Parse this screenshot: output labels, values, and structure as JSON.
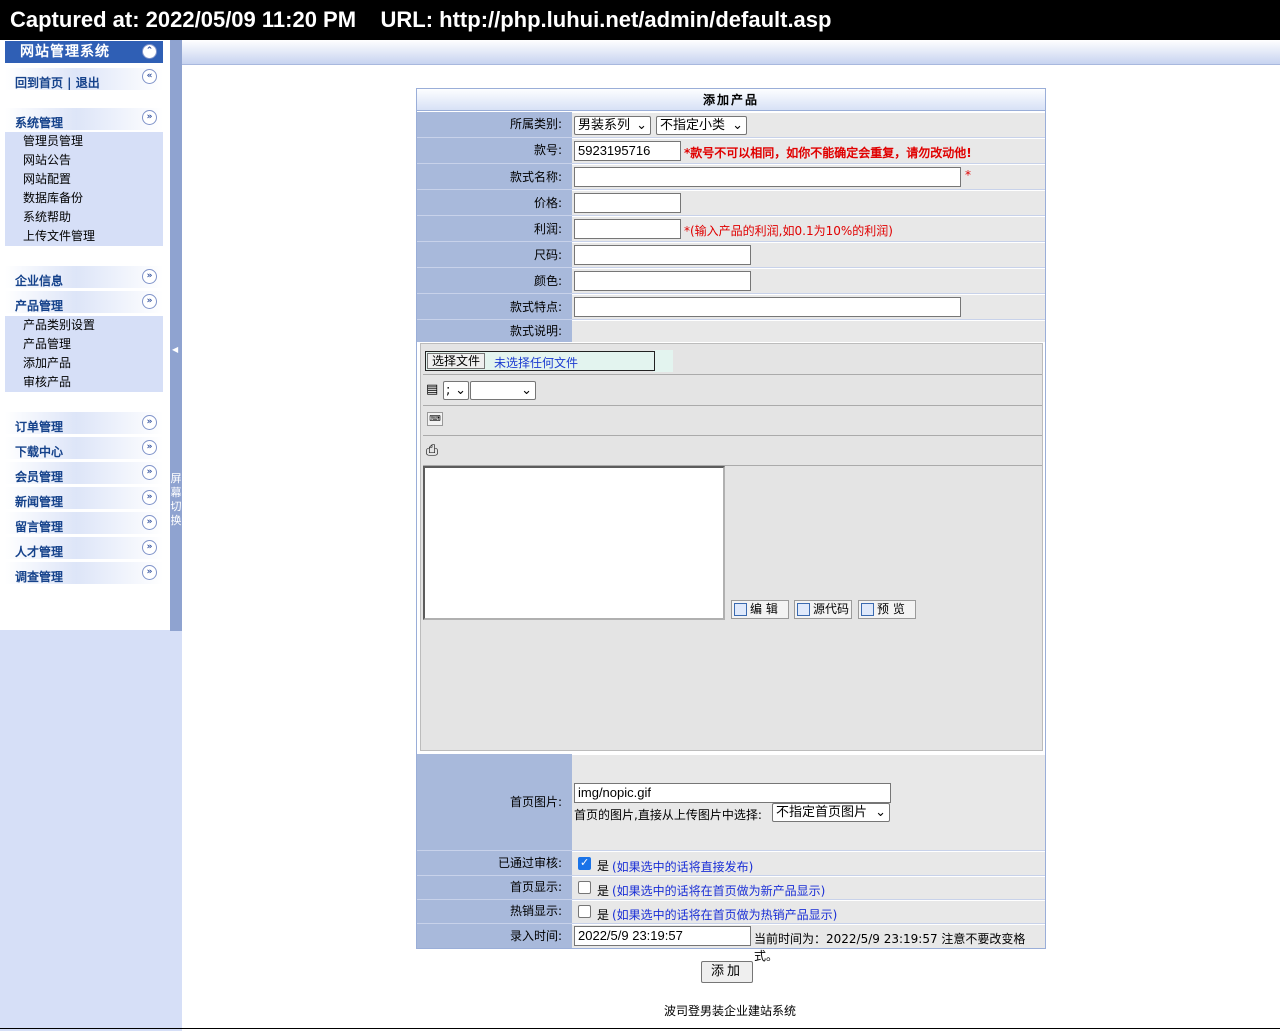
{
  "capture": {
    "text": "Captured at: 2022/05/09 11:20 PM    URL: http://php.luhui.net/admin/default.asp"
  },
  "sidebar": {
    "title": "网站管理系统",
    "top_link": "回到首页 | 退出",
    "groups": [
      {
        "label": "系统管理",
        "items": [
          "管理员管理",
          "网站公告",
          "网站配置",
          "数据库备份",
          "系统帮助",
          "上传文件管理"
        ]
      },
      {
        "label": "企业信息",
        "items": []
      },
      {
        "label": "产品管理",
        "items": [
          "产品类别设置",
          "产品管理",
          "添加产品",
          "审核产品"
        ]
      },
      {
        "label": "订单管理",
        "items": []
      },
      {
        "label": "下载中心",
        "items": []
      },
      {
        "label": "会员管理",
        "items": []
      },
      {
        "label": "新闻管理",
        "items": []
      },
      {
        "label": "留言管理",
        "items": []
      },
      {
        "label": "人才管理",
        "items": []
      },
      {
        "label": "调查管理",
        "items": []
      }
    ],
    "toggle_label": "屏幕切换"
  },
  "form": {
    "title": "添加产品",
    "category_label": "所属类别:",
    "category_main": "男装系列",
    "category_sub": "不指定小类",
    "code_label": "款号:",
    "code_value": "5923195716",
    "code_warning": "*款号不可以相同，如你不能确定会重复，请勿改动他!",
    "name_label": "款式名称:",
    "name_value": "",
    "required_mark": "*",
    "price_label": "价格:",
    "price_value": "",
    "profit_label": "利润:",
    "profit_value": "",
    "profit_hint": "*(输入产品的利润,如0.1为10%的利润)",
    "size_label": "尺码:",
    "size_value": "",
    "color_label": "颜色:",
    "color_value": "",
    "feature_label": "款式特点:",
    "feature_value": "",
    "desc_label": "款式说明:",
    "editor": {
      "file_button": "选择文件",
      "file_status": "未选择任何文件",
      "font_select": ";",
      "size_select": "",
      "mode_edit": "编 辑",
      "mode_source": "源代码",
      "mode_preview": "预 览"
    },
    "image_label": "首页图片:",
    "image_value": "img/nopic.gif",
    "image_hint": "首页的图片,直接从上传图片中选择:",
    "image_select": "不指定首页图片",
    "approved_label": "已通过审核:",
    "approved_checked": true,
    "yes": "是",
    "approved_hint": "(如果选中的话将直接发布)",
    "home_label": "首页显示:",
    "home_checked": false,
    "home_hint": "(如果选中的话将在首页做为新产品显示)",
    "hot_label": "热销显示:",
    "hot_checked": false,
    "hot_hint": "(如果选中的话将在首页做为热销产品显示)",
    "time_label": "录入时间:",
    "time_value": "2022/5/9 23:19:57",
    "time_hint": "当前时间为：2022/5/9 23:19:57 注意不要改变格式。",
    "submit": "添加"
  },
  "footer": {
    "text": "波司登男装企业建站系统"
  }
}
